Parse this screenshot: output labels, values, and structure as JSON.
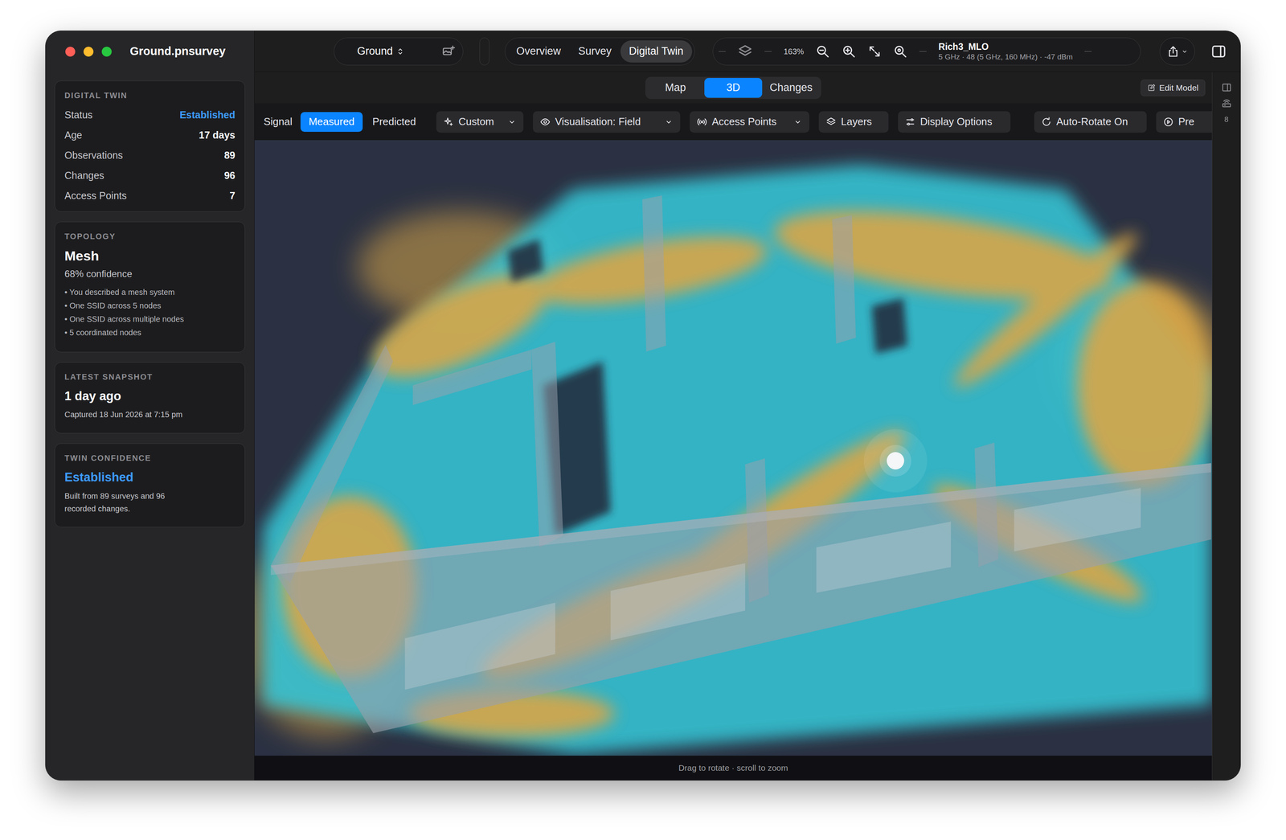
{
  "window": {
    "title": "Ground.pnsurvey"
  },
  "toolbar": {
    "floor": "Ground",
    "views": [
      {
        "label": "Overview",
        "selected": false
      },
      {
        "label": "Survey",
        "selected": false
      },
      {
        "label": "Digital Twin",
        "selected": true
      }
    ],
    "zoom": "163%",
    "network": {
      "name": "Rich3_MLO",
      "details": "5 GHz · 48 (5 GHz, 160 MHz) · -47 dBm"
    }
  },
  "modes": [
    {
      "label": "Map",
      "selected": false
    },
    {
      "label": "3D",
      "selected": true
    },
    {
      "label": "Changes",
      "selected": false
    }
  ],
  "edit_model": "Edit Model",
  "signal": {
    "label": "Signal",
    "options": [
      {
        "label": "Measured",
        "selected": true
      },
      {
        "label": "Predicted",
        "selected": false
      }
    ]
  },
  "controls": [
    {
      "label": "Custom",
      "kind": "menu"
    },
    {
      "label": "Visualisation: Field",
      "kind": "menu"
    },
    {
      "label": "Access Points",
      "kind": "menu"
    },
    {
      "label": "Layers",
      "kind": "button"
    },
    {
      "label": "Display Options",
      "kind": "button"
    },
    {
      "label": "Auto-Rotate On",
      "kind": "button"
    },
    {
      "label": "Pre",
      "kind": "button"
    }
  ],
  "canvas": {
    "hint": "Drag to rotate · scroll to zoom"
  },
  "rail": {
    "badge": "8"
  },
  "sidebar": {
    "digital_twin": {
      "heading": "DIGITAL TWIN",
      "rows": [
        {
          "label": "Status",
          "value": "Established",
          "color": "#3d9bff"
        },
        {
          "label": "Age",
          "value": "17 days",
          "color": "#ffffff"
        },
        {
          "label": "Observations",
          "value": "89",
          "color": "#ffffff"
        },
        {
          "label": "Changes",
          "value": "96",
          "color": "#ffffff"
        },
        {
          "label": "Access Points",
          "value": "7",
          "color": "#ffffff"
        }
      ]
    },
    "topology": {
      "heading": "TOPOLOGY",
      "title": "Mesh",
      "confidence": "68% confidence",
      "bullets": [
        "• You described a mesh system",
        "• One SSID across 5 nodes",
        "• One SSID across multiple nodes",
        "• 5 coordinated nodes"
      ]
    },
    "snapshot": {
      "heading": "LATEST SNAPSHOT",
      "title": "1 day ago",
      "detail": "Captured 18 Jun 2026 at 7:15 pm"
    },
    "twin_confidence": {
      "heading": "TWIN CONFIDENCE",
      "title": "Established",
      "detail": "Built from 89 surveys and 96 recorded changes."
    }
  }
}
